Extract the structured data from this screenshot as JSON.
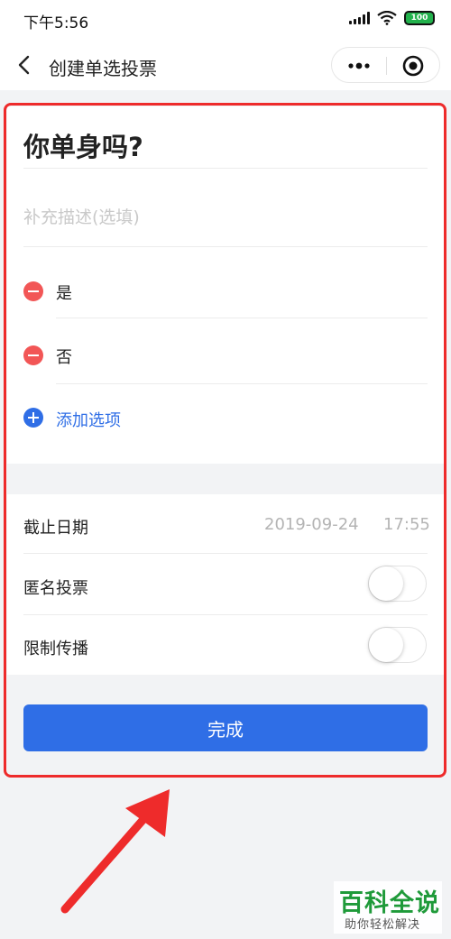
{
  "status_bar": {
    "time": "下午5:56",
    "battery": "100"
  },
  "nav": {
    "title": "创建单选投票"
  },
  "vote": {
    "title": "你单身吗?",
    "description_placeholder": "补充描述(选填)",
    "options": [
      {
        "label": "是"
      },
      {
        "label": "否"
      }
    ],
    "add_option_label": "添加选项"
  },
  "settings": {
    "deadline_label": "截止日期",
    "deadline_date": "2019-09-24",
    "deadline_time": "17:55",
    "anonymous_label": "匿名投票",
    "anonymous_on": false,
    "restrict_share_label": "限制传播",
    "restrict_share_on": false
  },
  "done_button": {
    "label": "完成"
  },
  "watermark": {
    "title": "百科全说",
    "subtitle": "助你轻松解决"
  },
  "colors": {
    "accent": "#2f6ee6",
    "remove": "#f25656",
    "highlight": "#ee2b2b",
    "watermark": "#1f9a3a"
  }
}
